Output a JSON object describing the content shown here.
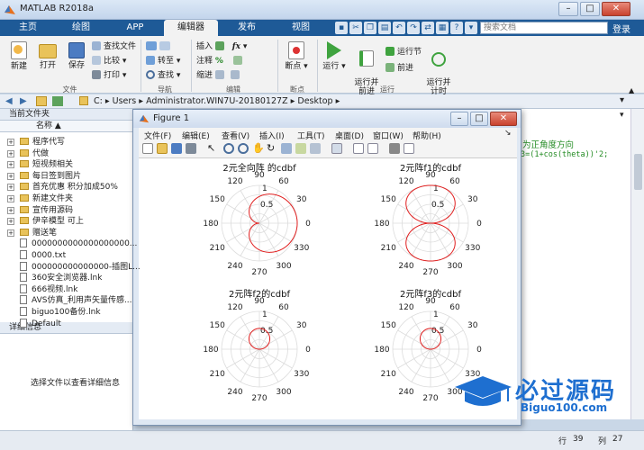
{
  "window": {
    "title": "MATLAB R2018a",
    "min": "–",
    "max": "□",
    "close": "✕"
  },
  "tabs": [
    "主页",
    "绘图",
    "APP",
    "编辑器",
    "发布",
    "视图"
  ],
  "search": {
    "placeholder": "搜索文档"
  },
  "login": "登录",
  "toolstrip": {
    "file": {
      "new": "新建",
      "open": "打开",
      "save": "保存",
      "find_files": "查找文件",
      "compare": "比较",
      "print": "打印",
      "group": "文件"
    },
    "nav": {
      "goto": "转至",
      "find": "查找",
      "group": "导航"
    },
    "edit": {
      "insert": "插入",
      "comment": "注释",
      "indent": "缩进",
      "fx": "fx",
      "group": "编辑"
    },
    "breakpoint": {
      "label": "断点",
      "group": "断点"
    },
    "run": {
      "run": "运行",
      "run_advance": "运行并\n前进",
      "run_section": "运行节",
      "advance": "前进",
      "run_time": "运行并\n计时",
      "group": "运行"
    }
  },
  "address": {
    "parts": [
      "C:",
      "Users",
      "Administrator.WIN7U-20180127Z",
      "Desktop"
    ]
  },
  "left_panel": {
    "title": "当前文件夹",
    "column": "名称 ▲",
    "items": [
      {
        "name": "程序代写",
        "type": "folder"
      },
      {
        "name": "代做",
        "type": "folder"
      },
      {
        "name": "短视频相关",
        "type": "folder"
      },
      {
        "name": "每日签到图片",
        "type": "folder"
      },
      {
        "name": "首充优惠 积分加成50%",
        "type": "folder"
      },
      {
        "name": "新建文件夹",
        "type": "folder"
      },
      {
        "name": "宣传用源码",
        "type": "folder"
      },
      {
        "name": "伊辛模型 可上",
        "type": "folder"
      },
      {
        "name": "赠送笔",
        "type": "folder"
      },
      {
        "name": "0000000000000000000...",
        "type": "file"
      },
      {
        "name": "0000.txt",
        "type": "file"
      },
      {
        "name": "000000000000000-插图L...",
        "type": "file"
      },
      {
        "name": "360安全浏览器.lnk",
        "type": "file"
      },
      {
        "name": "666视频.lnk",
        "type": "file"
      },
      {
        "name": "AVS仿真_利用声矢量传感...",
        "type": "file"
      },
      {
        "name": "biguo100备份.lnk",
        "type": "file"
      },
      {
        "name": "Default",
        "type": "file"
      }
    ]
  },
  "details": {
    "title": "详细信息",
    "hint": "选择文件以查看详细信息"
  },
  "editor": {
    "line1": "为正角度方向",
    "line2": "3=(1+cos(theta))'2;"
  },
  "status": {
    "row_label": "行",
    "row": "39",
    "col_label": "列",
    "col": "27"
  },
  "figure": {
    "title": "Figure 1",
    "menu": [
      "文件(F)",
      "编辑(E)",
      "查看(V)",
      "插入(I)",
      "工具(T)",
      "桌面(D)",
      "窗口(W)",
      "帮助(H)"
    ]
  },
  "watermark": {
    "text": "必过源码",
    "url": "Biguo100.com"
  },
  "chart_data": [
    {
      "type": "polar",
      "title": "2元全向阵 的cdbf",
      "angle_ticks": [
        "90",
        "60",
        "30",
        "0",
        "330",
        "300",
        "270",
        "240",
        "210",
        "180",
        "150",
        "120"
      ],
      "radial_ticks": [
        "0.5",
        "1"
      ],
      "pattern": "cardioid_forward",
      "color": "#e01e1e"
    },
    {
      "type": "polar",
      "title": "2元阵f1的cdbf",
      "angle_ticks": [
        "90",
        "60",
        "30",
        "0",
        "330",
        "300",
        "270",
        "240",
        "210",
        "180",
        "150",
        "120"
      ],
      "radial_ticks": [
        "0.5",
        "1"
      ],
      "pattern": "main_lobe_up",
      "color": "#e01e1e"
    },
    {
      "type": "polar",
      "title": "2元阵f2的cdbf",
      "angle_ticks": [
        "90",
        "60",
        "30",
        "0",
        "330",
        "300",
        "270",
        "240",
        "210",
        "180",
        "150",
        "120"
      ],
      "radial_ticks": [
        "0.5",
        "1"
      ],
      "pattern": "small_circle_up",
      "color": "#e01e1e"
    },
    {
      "type": "polar",
      "title": "2元阵f3的cdbf",
      "angle_ticks": [
        "90",
        "60",
        "30",
        "0",
        "330",
        "300",
        "270",
        "240",
        "210",
        "180",
        "150",
        "120"
      ],
      "radial_ticks": [
        "0.5",
        "1"
      ],
      "pattern": "small_circle_up",
      "color": "#e01e1e"
    }
  ]
}
